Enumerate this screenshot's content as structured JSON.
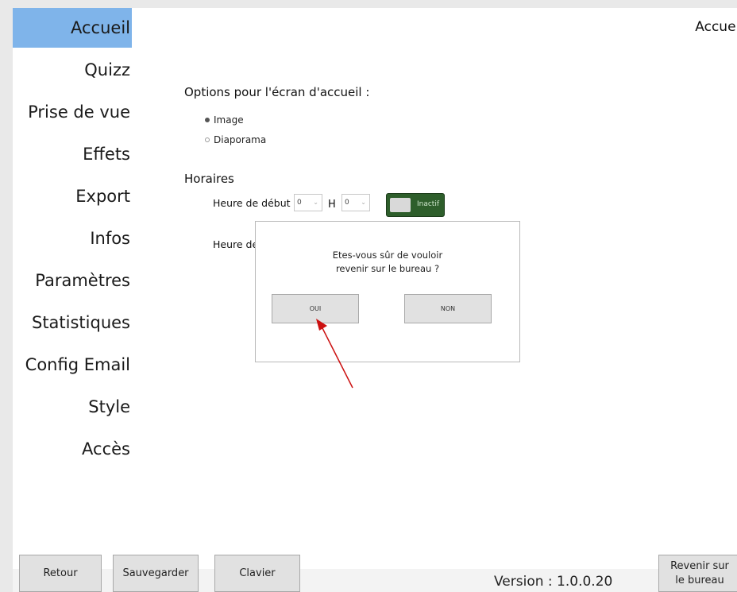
{
  "sidebar": {
    "items": [
      {
        "label": "Accueil",
        "active": true
      },
      {
        "label": "Quizz"
      },
      {
        "label": "Prise de vue"
      },
      {
        "label": "Effets"
      },
      {
        "label": "Export"
      },
      {
        "label": "Infos"
      },
      {
        "label": "Paramètres"
      },
      {
        "label": "Statistiques"
      },
      {
        "label": "Config Email"
      },
      {
        "label": "Style"
      },
      {
        "label": "Accès"
      }
    ],
    "active_color": "#7fb4ea"
  },
  "header": {
    "title": "Accueil"
  },
  "main": {
    "options_title": "Options pour l'écran d'accueil :",
    "radio_image": "Image",
    "radio_diaporama": "Diaporama",
    "selected_option": "Image",
    "horaires_title": "Horaires",
    "start_label": "Heure de début",
    "start_hour": "0",
    "hour_separator": "H",
    "start_minute": "0",
    "toggle_label": "Inactif",
    "end_label": "Heure de"
  },
  "dialog": {
    "line1": "Etes-vous sûr de vouloir",
    "line2": "revenir sur le bureau ?",
    "yes": "OUI",
    "no": "NON"
  },
  "footer": {
    "back": "Retour",
    "save": "Sauvegarder",
    "keyboard": "Clavier",
    "version": "Version : 1.0.0.20",
    "desktop_line1": "Revenir sur",
    "desktop_line2": "le bureau"
  },
  "colors": {
    "toggle_bg": "#2e5e2b",
    "arrow": "#cc1111"
  }
}
